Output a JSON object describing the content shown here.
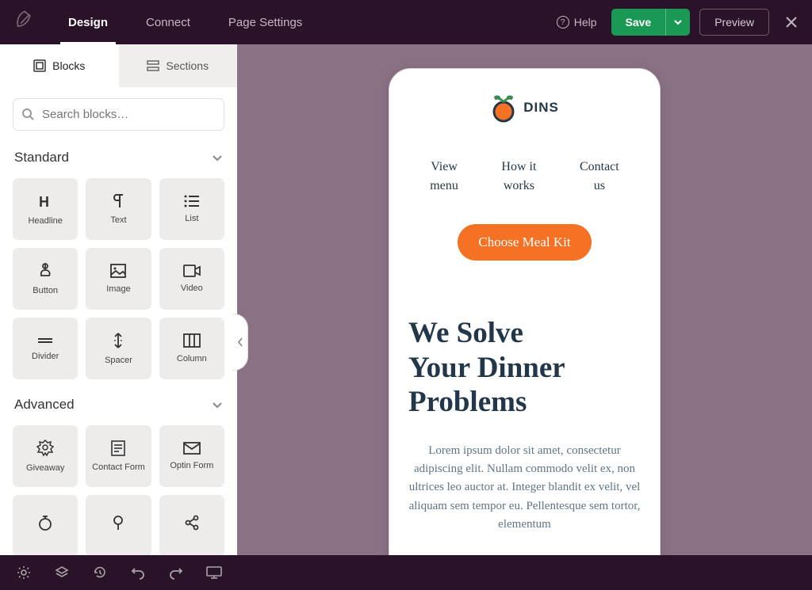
{
  "topbar": {
    "tabs": {
      "design": "Design",
      "connect": "Connect",
      "settings": "Page Settings"
    },
    "help": "Help",
    "save": "Save",
    "preview": "Preview"
  },
  "sidebar": {
    "tabs": {
      "blocks": "Blocks",
      "sections": "Sections"
    },
    "search_placeholder": "Search blocks…",
    "groups": {
      "standard": "Standard",
      "advanced": "Advanced"
    },
    "blocks": {
      "headline": "Headline",
      "text": "Text",
      "list": "List",
      "button": "Button",
      "image": "Image",
      "video": "Video",
      "divider": "Divider",
      "spacer": "Spacer",
      "column": "Column",
      "giveaway": "Giveaway",
      "contact_form": "Contact Form",
      "optin_form": "Optin Form"
    }
  },
  "preview": {
    "brand": "DINS",
    "nav": {
      "menu": {
        "l1": "View",
        "l2": "menu"
      },
      "how": {
        "l1": "How it",
        "l2": "works"
      },
      "contact": {
        "l1": "Contact",
        "l2": "us"
      }
    },
    "cta": "Choose Meal Kit",
    "hero_title_l1": "We Solve",
    "hero_title_l2": "Your Dinner",
    "hero_title_l3": "Problems",
    "hero_text": "Lorem ipsum dolor sit amet, consectetur adipiscing elit. Nullam commodo velit ex, non ultrices leo auctor at. Integer blandit ex velit, vel aliquam sem tempor eu. Pellentesque sem tortor, elementum"
  }
}
